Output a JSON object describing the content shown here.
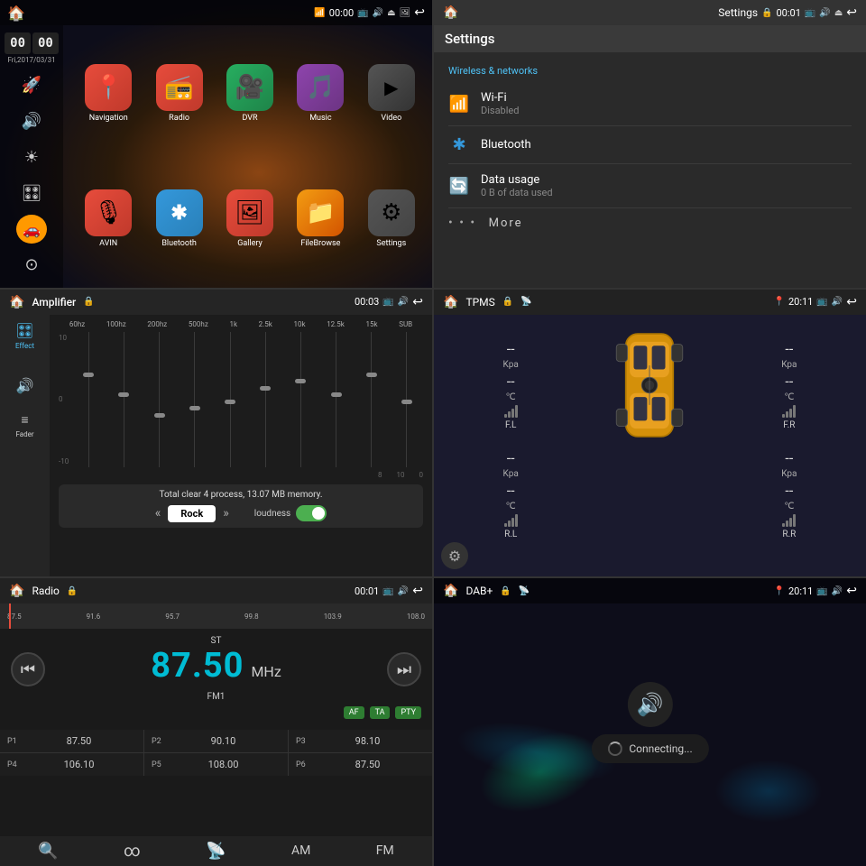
{
  "panels": {
    "home": {
      "title": "Home",
      "time": "00:00",
      "date": "Fri,2017/03/31",
      "time_hours": "00",
      "time_mins": "00",
      "apps": [
        {
          "id": "navigation",
          "label": "Navigation",
          "icon": "📍",
          "class": "nav-icon"
        },
        {
          "id": "radio",
          "label": "Radio",
          "icon": "📻",
          "class": "radio-icon"
        },
        {
          "id": "dvr",
          "label": "DVR",
          "icon": "🎥",
          "class": "dvr-icon"
        },
        {
          "id": "music",
          "label": "Music",
          "icon": "🎵",
          "class": "music-icon"
        },
        {
          "id": "video",
          "label": "Video",
          "icon": "▶",
          "class": "video-icon"
        },
        {
          "id": "avin",
          "label": "AVIN",
          "icon": "🎙",
          "class": "avin-icon"
        },
        {
          "id": "bluetooth",
          "label": "Bluetooth",
          "icon": "₿",
          "class": "bluetooth-icon"
        },
        {
          "id": "gallery",
          "label": "Gallery",
          "icon": "🖼",
          "class": "gallery-icon"
        },
        {
          "id": "filebrowse",
          "label": "FileBrowse",
          "icon": "📁",
          "class": "filebrowse-icon"
        },
        {
          "id": "settings",
          "label": "Settings",
          "icon": "⚙",
          "class": "settings-icon"
        }
      ]
    },
    "settings": {
      "title": "Settings",
      "time": "00:01",
      "section": "Wireless & networks",
      "items": [
        {
          "icon": "📶",
          "title": "Wi-Fi",
          "subtitle": "Disabled"
        },
        {
          "icon": "✱",
          "title": "Bluetooth",
          "subtitle": ""
        },
        {
          "icon": "🔄",
          "title": "Data usage",
          "subtitle": "0 B of data used"
        }
      ],
      "more": "More"
    },
    "amplifier": {
      "title": "Amplifier",
      "time": "00:03",
      "eq_labels": [
        "60hz",
        "100hz",
        "200hz",
        "500hz",
        "1k",
        "2.5k",
        "10k",
        "12.5k",
        "15k",
        "SUB"
      ],
      "eq_positions": [
        0.3,
        0.45,
        0.6,
        0.55,
        0.5,
        0.4,
        0.35,
        0.45,
        0.3,
        0.5
      ],
      "scale": [
        "10",
        "0",
        "-10"
      ],
      "message": "Total clear 4 process, 13.07 MB memory.",
      "preset": "Rock",
      "loudness_label": "loudness",
      "loudness_on": true,
      "effect_label": "Effect",
      "fader_label": "Fader"
    },
    "tpms": {
      "title": "TPMS",
      "time": "20:11",
      "wheels": {
        "fl": {
          "label": "F.L",
          "kpa": "--",
          "temp": "--"
        },
        "fr": {
          "label": "F.R",
          "kpa": "--",
          "temp": "--"
        },
        "rl": {
          "label": "R.L",
          "kpa": "--",
          "temp": "--"
        },
        "rr": {
          "label": "R.R",
          "kpa": "--",
          "temp": "--"
        }
      },
      "unit_kpa": "Kpa",
      "unit_temp": "℃"
    },
    "radio": {
      "title": "Radio",
      "time": "00:01",
      "freq_start": "87.5",
      "freq_marks": [
        "87.5",
        "91.6",
        "95.7",
        "99.8",
        "103.9",
        "108.0"
      ],
      "station_type": "ST",
      "band": "FM1",
      "frequency": "87.50",
      "unit": "MHz",
      "flags": [
        "AF",
        "TA",
        "PTY"
      ],
      "presets": [
        {
          "num": "P1",
          "freq": "87.50"
        },
        {
          "num": "P2",
          "freq": "90.10"
        },
        {
          "num": "P3",
          "freq": "98.10"
        },
        {
          "num": "P4",
          "freq": "106.10"
        },
        {
          "num": "P5",
          "freq": "108.00"
        },
        {
          "num": "P6",
          "freq": "87.50"
        }
      ],
      "bottom_buttons": [
        "🔍",
        "♾",
        "📡",
        "AM",
        "FM"
      ]
    },
    "dab": {
      "title": "DAB+",
      "time": "20:11",
      "connecting_text": "Connecting..."
    }
  }
}
